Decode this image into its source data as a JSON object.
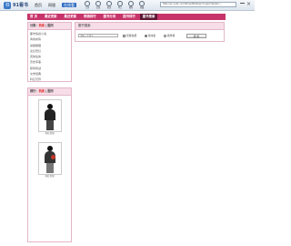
{
  "app": {
    "logo_text": "91看书",
    "logo_glyph": "书"
  },
  "nav_menu": [
    {
      "label": "首页",
      "active": false
    },
    {
      "label": "网银",
      "active": false
    },
    {
      "label": "在线看",
      "active": true
    }
  ],
  "tools": [
    {
      "label": "主页",
      "icon": "home-icon"
    },
    {
      "label": "后退",
      "icon": "back-icon"
    },
    {
      "label": "前进",
      "icon": "forward-icon"
    },
    {
      "label": "停止",
      "icon": "stop-icon"
    },
    {
      "label": "刷新",
      "icon": "refresh-icon"
    },
    {
      "label": "收藏",
      "icon": "favorite-icon"
    }
  ],
  "address": "http://pc.a.91.com/Shop/NS/Search.aspx?plate=...",
  "window": {
    "close_glyph": "×"
  },
  "tabs": [
    {
      "label": "首 页",
      "active": false
    },
    {
      "label": "最近更新",
      "active": false
    },
    {
      "label": "最近更新",
      "active": false
    },
    {
      "label": "畅销排行",
      "active": false
    },
    {
      "label": "图书分类",
      "active": false
    },
    {
      "label": "图书排行",
      "active": false
    },
    {
      "label": "图书搜索",
      "active": true
    }
  ],
  "sidebar": {
    "heading_prefix": "分类：",
    "heading_hot": "热卖",
    "heading_sep": " | ",
    "heading_suffix": "图书",
    "links": [
      "都市情感小说",
      "青春言情",
      "悬疑推理",
      "玄幻奇幻",
      "武侠仙侠",
      "历史军事",
      "职场商战",
      "文学经典",
      "科幻灵异"
    ]
  },
  "ranking": {
    "heading_prefix": "排行：",
    "heading_hot": "热卖",
    "heading_sep": " | ",
    "heading_suffix": "图书",
    "books": [
      {
        "title": "书名暂缺"
      },
      {
        "title": "书名暂缺"
      }
    ]
  },
  "search": {
    "heading": "图书搜索",
    "input_placeholder": "请输入关键字",
    "options": [
      {
        "type": "checkbox",
        "label": "仅搜免费",
        "checked": false
      },
      {
        "type": "radio",
        "label": "按书名",
        "checked": true
      },
      {
        "type": "radio",
        "label": "按作者",
        "checked": false
      }
    ],
    "button_label": "搜 索"
  },
  "colors": {
    "accent": "#c7346a",
    "active_tab": "#5d1834",
    "panel_head": "#f6dde7"
  }
}
